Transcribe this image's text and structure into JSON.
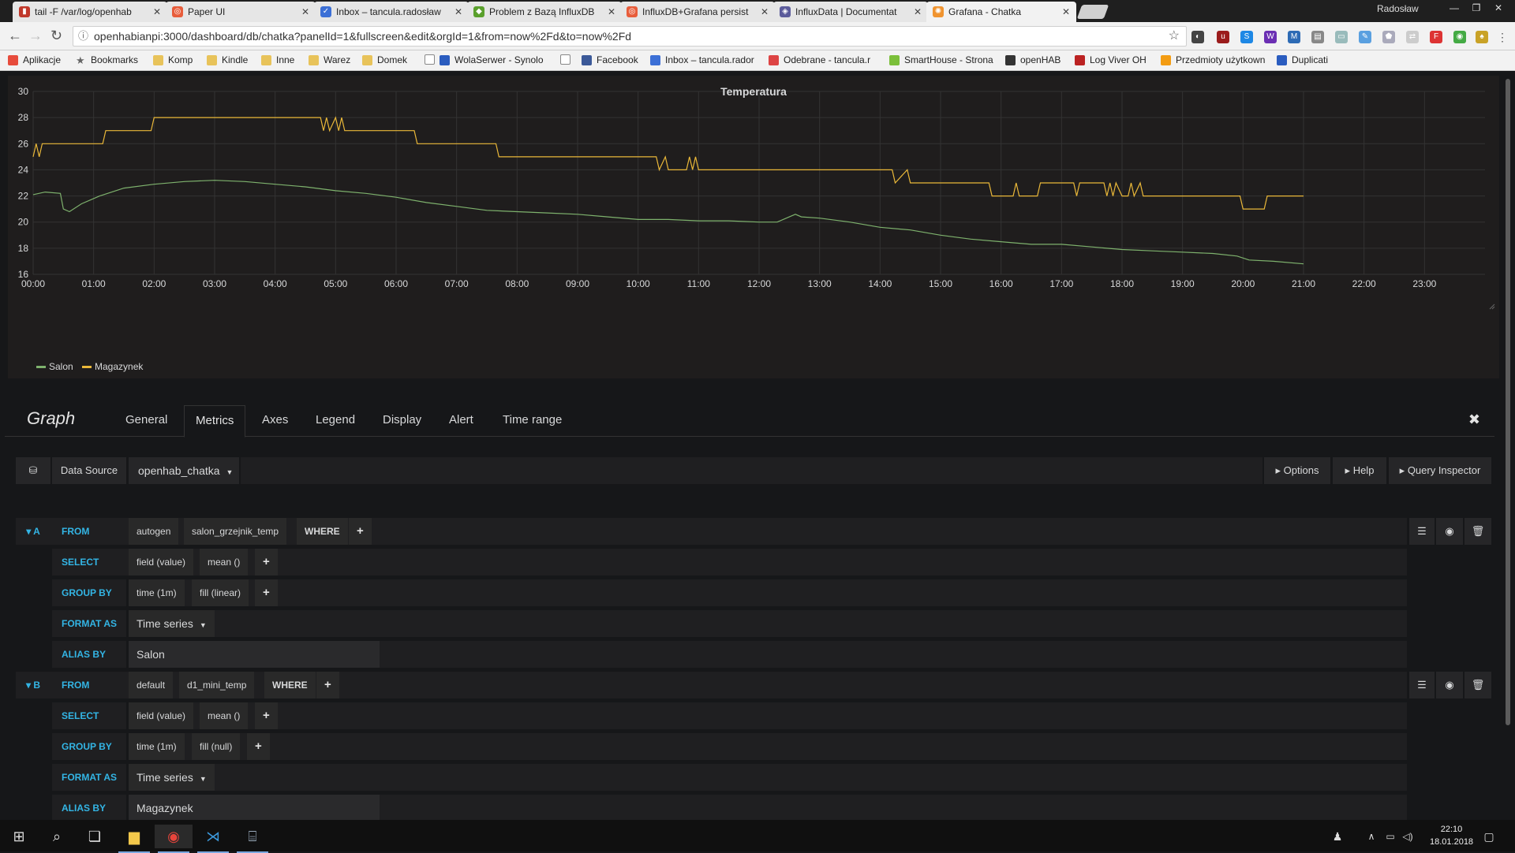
{
  "browser": {
    "tabs": [
      {
        "label": "tail -F /var/log/openhab",
        "icon": "terminal-icon",
        "color": "#c0392b"
      },
      {
        "label": "Paper UI",
        "icon": "openhab-icon",
        "color": "#e85d3b"
      },
      {
        "label": "Inbox – tancula.radosław",
        "icon": "inbox-icon",
        "color": "#3b6fd6"
      },
      {
        "label": "Problem z Bazą InfluxDB",
        "icon": "forum-icon",
        "color": "#5aa02c"
      },
      {
        "label": "InfluxDB+Grafana persist",
        "icon": "openhab-icon",
        "color": "#e85d3b"
      },
      {
        "label": "InfluxData | Documentat",
        "icon": "influx-icon",
        "color": "#5b5b9b"
      },
      {
        "label": "Grafana - Chatka",
        "icon": "grafana-icon",
        "color": "#f09430"
      }
    ],
    "window_user": "Radosław",
    "url": "openhabianpi:3000/dashboard/db/chatka?panelId=1&fullscreen&edit&orgId=1&from=now%2Fd&to=now%2Fd",
    "bookmarks": [
      {
        "label": "Aplikacje",
        "icon": "apps-icon"
      },
      {
        "label": "Bookmarks",
        "icon": "star-icon"
      },
      {
        "label": "Komp",
        "icon": "folder-icon"
      },
      {
        "label": "Kindle",
        "icon": "folder-icon"
      },
      {
        "label": "Inne",
        "icon": "folder-icon"
      },
      {
        "label": "Warez",
        "icon": "folder-icon"
      },
      {
        "label": "Domek",
        "icon": "folder-icon"
      },
      {
        "label": "WolaSerwer - Synolo",
        "icon": "dsm-icon"
      },
      {
        "label": "Facebook",
        "icon": "facebook-icon"
      },
      {
        "label": "Inbox – tancula.rador",
        "icon": "inbox-icon"
      },
      {
        "label": "Odebrane - tancula.r",
        "icon": "gmail-icon"
      },
      {
        "label": "SmartHouse - Strona",
        "icon": "smarthouse-icon"
      },
      {
        "label": "openHAB",
        "icon": "openhab-icon"
      },
      {
        "label": "Log Viver OH",
        "icon": "log-icon"
      },
      {
        "label": "Przedmioty użytkown",
        "icon": "items-icon"
      },
      {
        "label": "Duplicati",
        "icon": "duplicati-icon"
      }
    ]
  },
  "panel": {
    "title": "Temperatura",
    "legend": [
      {
        "name": "Salon",
        "color": "#7eb26d"
      },
      {
        "name": "Magazynek",
        "color": "#eab839"
      }
    ]
  },
  "chart_data": {
    "type": "line",
    "title": "Temperatura",
    "xlabel": "",
    "ylabel": "",
    "x_ticks": [
      "00:00",
      "01:00",
      "02:00",
      "03:00",
      "04:00",
      "05:00",
      "06:00",
      "07:00",
      "08:00",
      "09:00",
      "10:00",
      "11:00",
      "12:00",
      "13:00",
      "14:00",
      "15:00",
      "16:00",
      "17:00",
      "18:00",
      "19:00",
      "20:00",
      "21:00",
      "22:00",
      "23:00"
    ],
    "y_ticks": [
      16,
      18,
      20,
      22,
      24,
      26,
      28,
      30
    ],
    "ylim": [
      16,
      30
    ],
    "xlim_hours": [
      0,
      24
    ],
    "grid": true,
    "legend_position": "bottom-left",
    "series": [
      {
        "name": "Salon",
        "color": "#7eb26d",
        "points": [
          [
            0.0,
            22.1
          ],
          [
            0.2,
            22.3
          ],
          [
            0.45,
            22.2
          ],
          [
            0.5,
            21.0
          ],
          [
            0.6,
            20.8
          ],
          [
            0.8,
            21.4
          ],
          [
            1.1,
            22.0
          ],
          [
            1.5,
            22.6
          ],
          [
            2.0,
            22.9
          ],
          [
            2.5,
            23.1
          ],
          [
            3.0,
            23.2
          ],
          [
            3.5,
            23.1
          ],
          [
            4.0,
            22.9
          ],
          [
            4.5,
            22.7
          ],
          [
            5.0,
            22.4
          ],
          [
            5.5,
            22.2
          ],
          [
            6.0,
            21.9
          ],
          [
            6.5,
            21.5
          ],
          [
            7.0,
            21.2
          ],
          [
            7.5,
            20.9
          ],
          [
            8.0,
            20.8
          ],
          [
            8.5,
            20.7
          ],
          [
            9.0,
            20.6
          ],
          [
            9.5,
            20.4
          ],
          [
            10.0,
            20.2
          ],
          [
            10.5,
            20.2
          ],
          [
            11.0,
            20.1
          ],
          [
            11.5,
            20.1
          ],
          [
            12.0,
            20.0
          ],
          [
            12.3,
            20.0
          ],
          [
            12.5,
            20.4
          ],
          [
            12.6,
            20.6
          ],
          [
            12.7,
            20.4
          ],
          [
            13.0,
            20.3
          ],
          [
            13.5,
            20.0
          ],
          [
            14.0,
            19.6
          ],
          [
            14.5,
            19.4
          ],
          [
            15.0,
            19.0
          ],
          [
            15.5,
            18.7
          ],
          [
            16.0,
            18.5
          ],
          [
            16.5,
            18.3
          ],
          [
            17.0,
            18.3
          ],
          [
            17.5,
            18.1
          ],
          [
            18.0,
            17.9
          ],
          [
            18.5,
            17.8
          ],
          [
            19.0,
            17.7
          ],
          [
            19.5,
            17.6
          ],
          [
            19.9,
            17.4
          ],
          [
            20.1,
            17.1
          ],
          [
            20.5,
            17.0
          ],
          [
            21.0,
            16.8
          ]
        ]
      },
      {
        "name": "Magazynek",
        "color": "#eab839",
        "points": [
          [
            0.0,
            25.0
          ],
          [
            0.05,
            26.0
          ],
          [
            0.1,
            25.0
          ],
          [
            0.15,
            26.0
          ],
          [
            1.15,
            26.0
          ],
          [
            1.2,
            27.0
          ],
          [
            1.95,
            27.0
          ],
          [
            2.0,
            28.0
          ],
          [
            4.75,
            28.0
          ],
          [
            4.8,
            27.0
          ],
          [
            4.85,
            28.0
          ],
          [
            4.9,
            27.0
          ],
          [
            5.0,
            28.0
          ],
          [
            5.05,
            27.0
          ],
          [
            5.1,
            28.0
          ],
          [
            5.15,
            27.0
          ],
          [
            6.3,
            27.0
          ],
          [
            6.35,
            26.0
          ],
          [
            7.65,
            26.0
          ],
          [
            7.7,
            25.0
          ],
          [
            10.3,
            25.0
          ],
          [
            10.35,
            24.0
          ],
          [
            10.45,
            25.0
          ],
          [
            10.5,
            24.0
          ],
          [
            10.8,
            24.0
          ],
          [
            10.85,
            25.0
          ],
          [
            10.9,
            24.0
          ],
          [
            10.95,
            25.0
          ],
          [
            11.0,
            24.0
          ],
          [
            14.2,
            24.0
          ],
          [
            14.25,
            23.0
          ],
          [
            14.45,
            24.0
          ],
          [
            14.5,
            23.0
          ],
          [
            15.8,
            23.0
          ],
          [
            15.85,
            22.0
          ],
          [
            16.2,
            22.0
          ],
          [
            16.25,
            23.0
          ],
          [
            16.3,
            22.0
          ],
          [
            16.6,
            22.0
          ],
          [
            16.65,
            23.0
          ],
          [
            17.2,
            23.0
          ],
          [
            17.25,
            22.0
          ],
          [
            17.3,
            23.0
          ],
          [
            17.7,
            23.0
          ],
          [
            17.75,
            22.0
          ],
          [
            17.8,
            23.0
          ],
          [
            17.85,
            22.0
          ],
          [
            17.9,
            23.0
          ],
          [
            18.0,
            22.0
          ],
          [
            18.1,
            22.0
          ],
          [
            18.15,
            23.0
          ],
          [
            18.2,
            22.0
          ],
          [
            18.3,
            23.0
          ],
          [
            18.35,
            22.0
          ],
          [
            19.95,
            22.0
          ],
          [
            20.0,
            21.0
          ],
          [
            20.35,
            21.0
          ],
          [
            20.4,
            22.0
          ],
          [
            21.0,
            22.0
          ]
        ]
      }
    ]
  },
  "editor": {
    "title": "Graph",
    "tabs": [
      "General",
      "Metrics",
      "Axes",
      "Legend",
      "Display",
      "Alert",
      "Time range"
    ],
    "active_tab": "Metrics",
    "datasource_label": "Data Source",
    "datasource_value": "openhab_chatka",
    "options_label": "Options",
    "help_label": "Help",
    "inspector_label": "Query Inspector"
  },
  "queries": [
    {
      "ref": "A",
      "from_label": "FROM",
      "policy": "autogen",
      "measurement": "salon_grzejnik_temp",
      "where_label": "WHERE",
      "select_label": "SELECT",
      "select_field": "field (value)",
      "select_fn": "mean ()",
      "group_label": "GROUP BY",
      "group_time": "time (1m)",
      "group_fill": "fill (linear)",
      "format_label": "FORMAT AS",
      "format_value": "Time series",
      "alias_label": "ALIAS BY",
      "alias_value": "Salon"
    },
    {
      "ref": "B",
      "from_label": "FROM",
      "policy": "default",
      "measurement": "d1_mini_temp",
      "where_label": "WHERE",
      "select_label": "SELECT",
      "select_field": "field (value)",
      "select_fn": "mean ()",
      "group_label": "GROUP BY",
      "group_time": "time (1m)",
      "group_fill": "fill (null)",
      "format_label": "FORMAT AS",
      "format_value": "Time series",
      "alias_label": "ALIAS BY",
      "alias_value": "Magazynek"
    }
  ],
  "taskbar": {
    "time": "22:10",
    "date": "18.01.2018"
  },
  "colors": {
    "accent": "#33b5e5",
    "panel_bg": "#1f1d1d",
    "page_bg": "#161719"
  }
}
